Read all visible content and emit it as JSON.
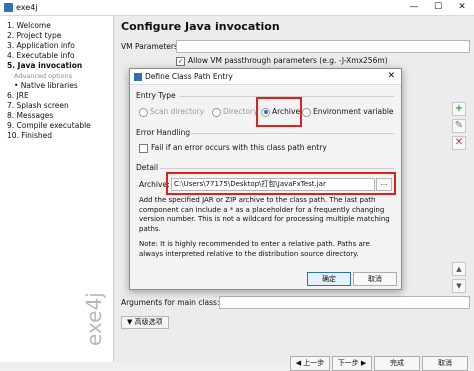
{
  "window": {
    "title": "exe4j",
    "minimize": "—",
    "maximize": "☐",
    "close": "✕"
  },
  "sidebar": {
    "steps": [
      {
        "label": "1. Welcome"
      },
      {
        "label": "2. Project type"
      },
      {
        "label": "3. Application info"
      },
      {
        "label": "4. Executable info"
      },
      {
        "label": "5. Java invocation"
      },
      {
        "label": "Advanced options"
      },
      {
        "label": "• Native libraries"
      },
      {
        "label": "6. JRE"
      },
      {
        "label": "7. Splash screen"
      },
      {
        "label": "8. Messages"
      },
      {
        "label": "9. Compile executable"
      },
      {
        "label": "10. Finished"
      }
    ],
    "watermark": "exe4j"
  },
  "main": {
    "title": "Configure Java invocation",
    "vm_label": "VM Parameters:",
    "vm_value": "",
    "allow_vm_label": "Allow VM passthrough parameters (e.g. -J-Xmx256m)",
    "args_label": "Arguments for main class:",
    "args_value": "",
    "advanced_label": "▼ 高级选项",
    "prev_label": "◀ 上一步",
    "next_label": "下一步 ▶",
    "finish_label": "完成",
    "cancel_label": "取消",
    "side_buttons": [
      "+",
      "✎",
      "✕",
      "▲",
      "▼"
    ]
  },
  "dialog": {
    "title": "Define Class Path Entry",
    "close": "✕",
    "entry_type_label": "Entry Type",
    "options": [
      {
        "label": "Scan directory",
        "selected": false,
        "enabled": false
      },
      {
        "label": "Directory",
        "selected": false,
        "enabled": false
      },
      {
        "label": "Archive",
        "selected": true,
        "enabled": true
      },
      {
        "label": "Environment variable",
        "selected": false,
        "enabled": true
      }
    ],
    "error_handling_label": "Error Handling",
    "fail_label": "Fail if an error occurs with this class path entry",
    "detail_label": "Detail",
    "archive_label": "Archive:",
    "archive_value": "C:\\Users\\77175\\Desktop\\打包\\JavaFxTest.jar",
    "browse_label": "...",
    "description": "Add the specified JAR or ZIP archive to the class path. The last path component can include a * as a placeholder for a frequently changing version number. This is not a wildcard for processing multiple matching paths.",
    "note": "Note: It is highly recommended to enter a relative path. Paths are always interpreted relative to the distribution source directory.",
    "ok_label": "确定",
    "cancel_label": "取消"
  },
  "colors": {
    "accent": "#2f6fb3",
    "highlight": "#e0201b",
    "plus_icon": "#2e9a3c",
    "remove_icon": "#d23a2a"
  }
}
